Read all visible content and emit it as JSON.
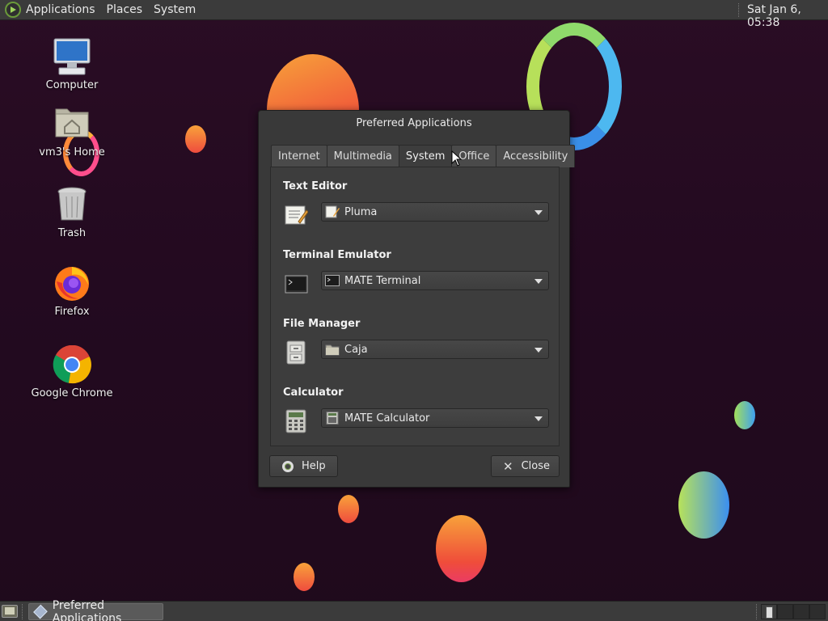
{
  "top_panel": {
    "menus": [
      "Applications",
      "Places",
      "System"
    ],
    "clock": "Sat Jan  6, 05:38"
  },
  "desktop_icons": [
    {
      "label": "Computer",
      "icon": "computer-icon"
    },
    {
      "label": "vm3's Home",
      "icon": "home-folder-icon"
    },
    {
      "label": "Trash",
      "icon": "trash-icon"
    },
    {
      "label": "Firefox",
      "icon": "firefox-icon"
    },
    {
      "label": "Google Chrome",
      "icon": "chrome-icon"
    }
  ],
  "dialog": {
    "title": "Preferred Applications",
    "tabs": [
      "Internet",
      "Multimedia",
      "System",
      "Office",
      "Accessibility"
    ],
    "active_tab": "System",
    "sections": [
      {
        "title": "Text Editor",
        "value": "Pluma",
        "icon": "text-editor-icon"
      },
      {
        "title": "Terminal Emulator",
        "value": "MATE Terminal",
        "icon": "terminal-icon"
      },
      {
        "title": "File Manager",
        "value": "Caja",
        "icon": "file-manager-icon"
      },
      {
        "title": "Calculator",
        "value": "MATE Calculator",
        "icon": "calculator-icon"
      }
    ],
    "help_label": "Help",
    "close_label": "Close"
  },
  "bottom_panel": {
    "task_label": "Preferred Applications"
  }
}
